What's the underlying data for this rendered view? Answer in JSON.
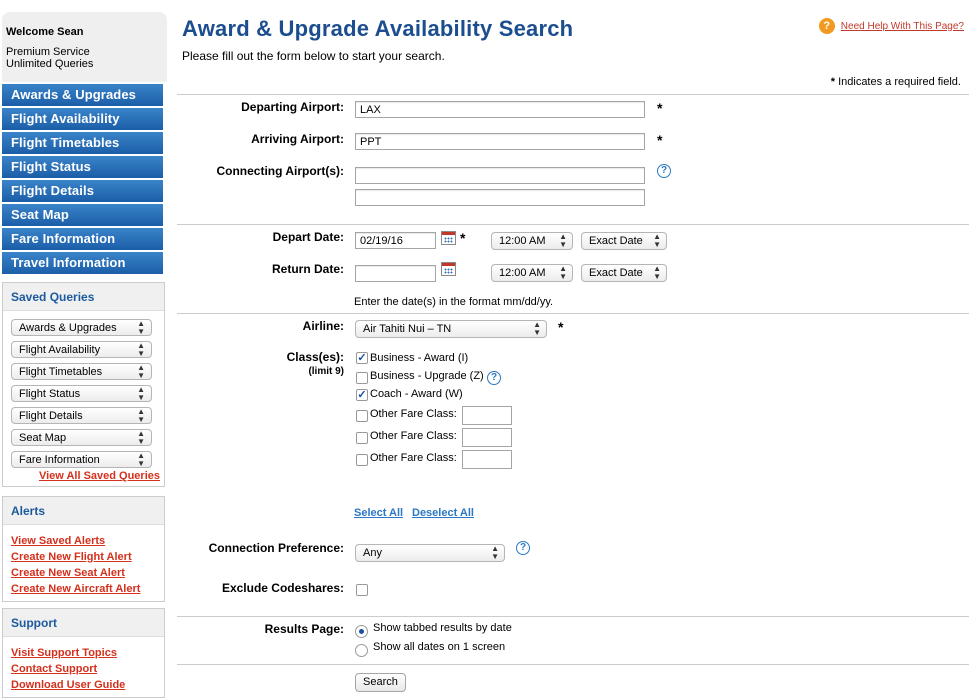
{
  "sidebar": {
    "welcome": "Welcome Sean",
    "service": "Premium Service",
    "queries": "Unlimited Queries",
    "nav": [
      "Awards & Upgrades",
      "Flight Availability",
      "Flight Timetables",
      "Flight Status",
      "Flight Details",
      "Seat Map",
      "Fare Information",
      "Travel Information"
    ],
    "saved_queries": {
      "title": "Saved Queries",
      "items": [
        "Awards & Upgrades",
        "Flight Availability",
        "Flight Timetables",
        "Flight Status",
        "Flight Details",
        "Seat Map",
        "Fare Information"
      ],
      "view_all": "View All Saved Queries"
    },
    "alerts": {
      "title": "Alerts",
      "links": [
        "View Saved Alerts",
        "Create New Flight Alert",
        "Create New Seat Alert",
        "Create New Aircraft Alert"
      ]
    },
    "support": {
      "title": "Support",
      "links": [
        "Visit Support Topics",
        "Contact Support",
        "Download User Guide"
      ]
    }
  },
  "main": {
    "title": "Award & Upgrade Availability Search",
    "subtitle": "Please fill out the form below to start your search.",
    "help_link": "Need Help With This Page?",
    "required_star": "*",
    "required_note": "Indicates a required field.",
    "form": {
      "departing_label": "Departing Airport:",
      "departing_value": "LAX",
      "arriving_label": "Arriving Airport:",
      "arriving_value": "PPT",
      "connecting_label": "Connecting Airport(s):",
      "connecting_value_1": "",
      "connecting_value_2": "",
      "depart_date_label": "Depart Date:",
      "depart_date_value": "02/19/16",
      "depart_time": "12:00 AM",
      "depart_exact": "Exact Date",
      "return_date_label": "Return Date:",
      "return_date_value": "",
      "return_time": "12:00 AM",
      "return_exact": "Exact Date",
      "date_note": "Enter the date(s) in the format mm/dd/yy.",
      "airline_label": "Airline:",
      "airline_value": "Air Tahiti Nui – TN",
      "classes_label": "Class(es):",
      "classes_limit": "(limit 9)",
      "classes": [
        {
          "label": "Business - Award (I)",
          "checked": true
        },
        {
          "label": "Business - Upgrade (Z)",
          "checked": false
        },
        {
          "label": "Coach - Award (W)",
          "checked": true
        },
        {
          "label": "Other Fare Class:",
          "checked": false
        },
        {
          "label": "Other Fare Class:",
          "checked": false
        },
        {
          "label": "Other Fare Class:",
          "checked": false
        }
      ],
      "select_all": "Select All",
      "deselect_all": "Deselect All",
      "connection_label": "Connection Preference:",
      "connection_value": "Any",
      "codeshares_label": "Exclude Codeshares:",
      "results_label": "Results Page:",
      "results_options": [
        {
          "label": "Show tabbed results by date",
          "selected": true
        },
        {
          "label": "Show all dates on 1 screen",
          "selected": false
        }
      ],
      "search_button": "Search"
    }
  },
  "colors": {
    "nav_blue": "#1b5ea8",
    "title_blue": "#1c4e8f",
    "link_red": "#d4301c",
    "help_orange": "#f29a1f"
  },
  "icons": {
    "help": "question-mark-icon",
    "calendar": "calendar-icon",
    "dropdown": "updown-arrows-icon"
  }
}
